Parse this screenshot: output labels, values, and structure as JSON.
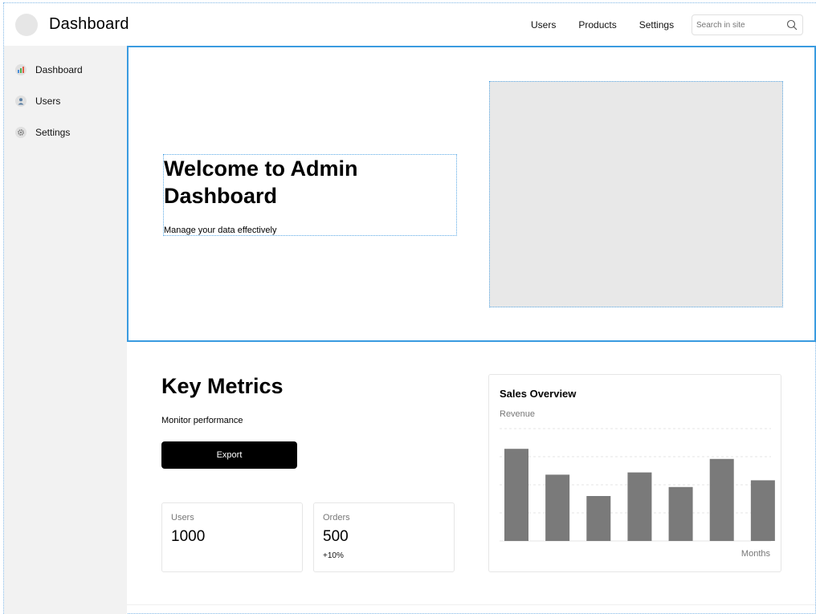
{
  "header": {
    "title": "Dashboard",
    "nav": [
      "Users",
      "Products",
      "Settings"
    ],
    "search_placeholder": "Search in site"
  },
  "sidebar": {
    "items": [
      {
        "label": "Dashboard",
        "icon": "bar-chart-icon"
      },
      {
        "label": "Users",
        "icon": "user-icon"
      },
      {
        "label": "Settings",
        "icon": "gear-icon"
      }
    ]
  },
  "hero": {
    "title": "Welcome to Admin Dashboard",
    "subtitle": "Manage your data effectively"
  },
  "metrics": {
    "title": "Key Metrics",
    "subtitle": "Monitor performance",
    "export_label": "Export",
    "cards": [
      {
        "label": "Users",
        "value": "1000",
        "change": ""
      },
      {
        "label": "Orders",
        "value": "500",
        "change": "+10%"
      }
    ]
  },
  "chart_card": {
    "title": "Sales Overview"
  },
  "chart_data": {
    "type": "bar",
    "title": "Sales Overview",
    "ylabel": "Revenue",
    "xlabel": "Months",
    "categories": [],
    "values": [
      82,
      59,
      40,
      61,
      48,
      73,
      54
    ],
    "ylim": [
      0,
      100
    ],
    "grid": true,
    "bar_color": "#7a7a7a"
  }
}
